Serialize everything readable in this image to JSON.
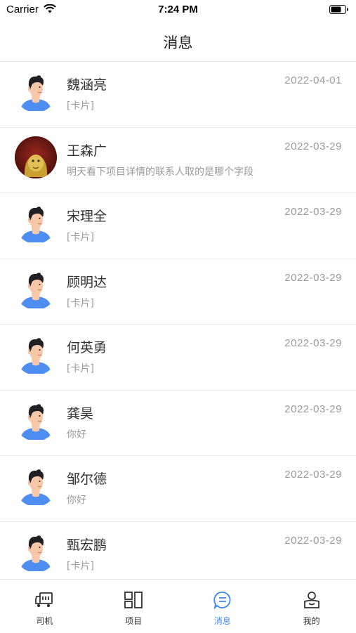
{
  "status_bar": {
    "carrier": "Carrier",
    "time": "7:24 PM"
  },
  "header": {
    "title": "消息"
  },
  "messages": [
    {
      "name": "魏涵亮",
      "date": "2022-04-01",
      "preview": "[卡片]",
      "avatar": "cartoon-man"
    },
    {
      "name": "王森广",
      "date": "2022-03-29",
      "preview": "明天看下项目详情的联系人取的是哪个字段",
      "avatar": "photo-lion"
    },
    {
      "name": "宋理全",
      "date": "2022-03-29",
      "preview": "[卡片]",
      "avatar": "cartoon-man"
    },
    {
      "name": "顾明达",
      "date": "2022-03-29",
      "preview": "[卡片]",
      "avatar": "cartoon-man"
    },
    {
      "name": "何英勇",
      "date": "2022-03-29",
      "preview": "[卡片]",
      "avatar": "cartoon-man"
    },
    {
      "name": "龚昊",
      "date": "2022-03-29",
      "preview": "你好",
      "avatar": "cartoon-man"
    },
    {
      "name": "邹尔德",
      "date": "2022-03-29",
      "preview": "你好",
      "avatar": "cartoon-man"
    },
    {
      "name": "甄宏鹏",
      "date": "2022-03-29",
      "preview": "[卡片]",
      "avatar": "cartoon-man"
    }
  ],
  "tabbar": [
    {
      "label": "司机",
      "icon": "truck-icon",
      "active": false
    },
    {
      "label": "项目",
      "icon": "grid-icon",
      "active": false
    },
    {
      "label": "消息",
      "icon": "message-icon",
      "active": true
    },
    {
      "label": "我的",
      "icon": "user-icon",
      "active": false
    }
  ],
  "colors": {
    "accent": "#3d86f5",
    "avatar_shirt": "#4e8ef3",
    "hair": "#1f1f24",
    "skin": "#f6c7a8"
  }
}
